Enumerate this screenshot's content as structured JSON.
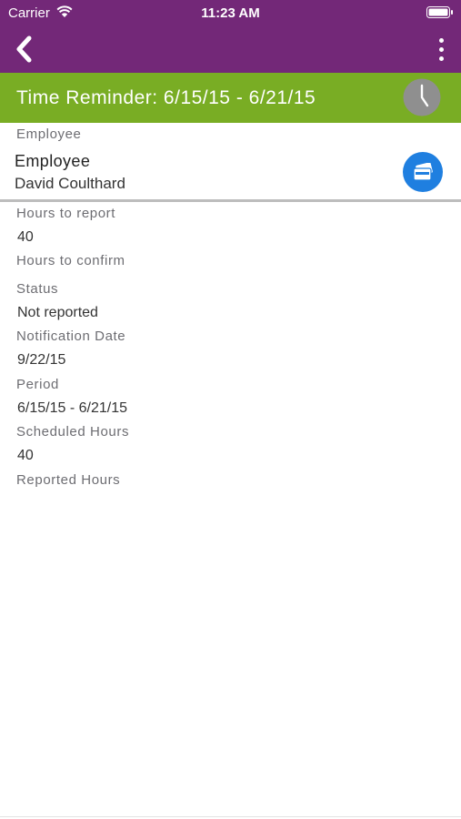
{
  "status_bar": {
    "carrier": "Carrier",
    "time": "11:23 AM"
  },
  "nav": {
    "back_icon": "chevron-left-icon",
    "more_icon": "more-vertical-icon"
  },
  "banner": {
    "title": "Time Reminder: 6/15/15 - 6/21/15",
    "icon": "clock-icon",
    "color": "#79ad24"
  },
  "colors": {
    "header": "#732878",
    "accent_blue": "#1f7fe0"
  },
  "employee": {
    "section_label": "Employee",
    "name_label": "Employee",
    "name": "David Coulthard",
    "action_icon": "card-icon"
  },
  "fields": [
    {
      "label": "Hours to report",
      "value": "40"
    },
    {
      "label": "Hours to confirm",
      "value": ""
    },
    {
      "label": "Status",
      "value": "Not reported"
    },
    {
      "label": "Notification Date",
      "value": "9/22/15"
    },
    {
      "label": "Period",
      "value": "6/15/15 - 6/21/15"
    },
    {
      "label": "Scheduled Hours",
      "value": "40"
    },
    {
      "label": "Reported Hours",
      "value": ""
    }
  ]
}
